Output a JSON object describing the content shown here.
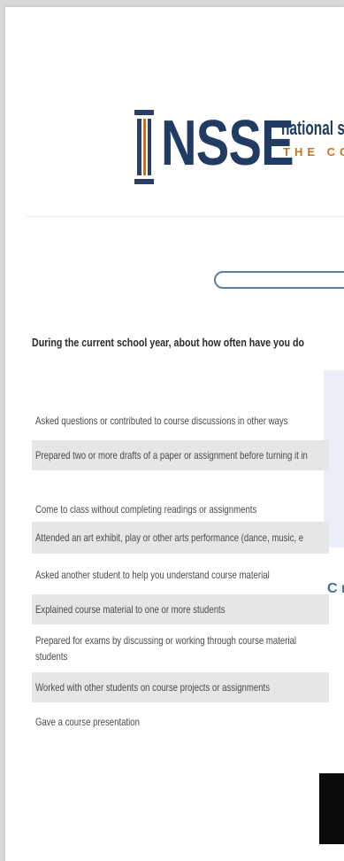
{
  "header": {
    "brand": "NSSE",
    "brand_sub": "national s",
    "brand_sub2": "THE CO",
    "colors": {
      "navy": "#213b63",
      "orange": "#c8741f"
    }
  },
  "survey": {
    "question": "During the current school year, about how often have you do",
    "items": [
      "Asked questions or contributed to course discussions in other ways",
      "Prepared two or more drafts of a paper or assignment before turning it in",
      "Come to class without completing readings or assignments",
      "Attended an art exhibit, play or other arts performance (dance, music, e",
      "Asked another student to help you understand course material",
      "Explained course material to one or more students",
      "Prepared for exams by discussing or working through course material students",
      "Worked with other students on course projects or assignments",
      "Gave a course presentation"
    ]
  },
  "side_note": "C r"
}
